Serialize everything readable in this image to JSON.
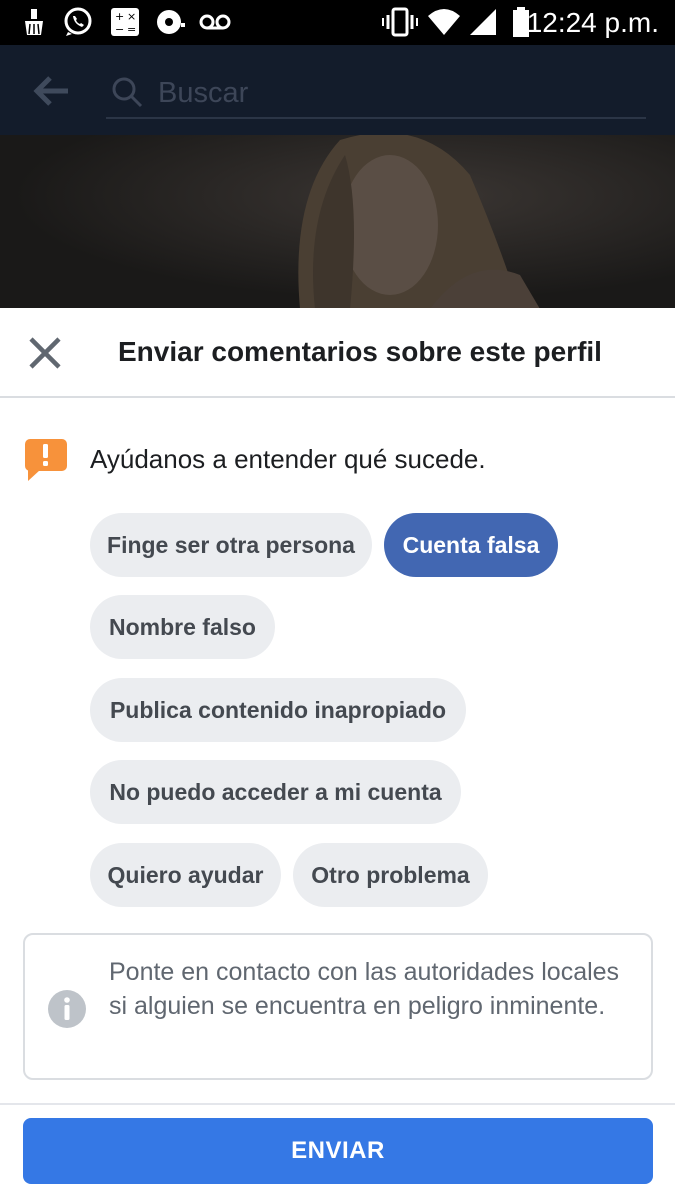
{
  "status_bar": {
    "time": "12:24 p.m.",
    "icons": [
      "cleaner-icon",
      "whatsapp-icon",
      "calculator-icon",
      "media-icon",
      "voicemail-icon",
      "vibrate-icon",
      "wifi-icon",
      "signal-icon",
      "battery-icon"
    ]
  },
  "search": {
    "placeholder": "Buscar",
    "back_icon": "back-arrow-icon",
    "search_icon": "search-icon"
  },
  "sheet": {
    "title": "Enviar comentarios sobre este perfil",
    "close_icon": "close-icon",
    "prompt": "Ayúdanos a entender qué sucede.",
    "prompt_icon": "alert-icon",
    "prompt_icon_color": "#f7923b",
    "options": [
      {
        "label": "Finge ser otra persona",
        "selected": false
      },
      {
        "label": "Cuenta falsa",
        "selected": true
      },
      {
        "label": "Nombre falso",
        "selected": false
      },
      {
        "label": "Publica contenido inapropiado",
        "selected": false
      },
      {
        "label": "No puedo acceder a mi cuenta",
        "selected": false
      },
      {
        "label": "Quiero ayudar",
        "selected": false
      },
      {
        "label": "Otro problema",
        "selected": false
      }
    ],
    "info_text": "Ponte en contacto con las autoridades locales si alguien se encuentra en peligro inminente.",
    "info_icon": "info-icon",
    "submit_label": "ENVIAR"
  },
  "colors": {
    "accent": "#4267b2",
    "button": "#3578e5",
    "warning": "#f7923b"
  }
}
